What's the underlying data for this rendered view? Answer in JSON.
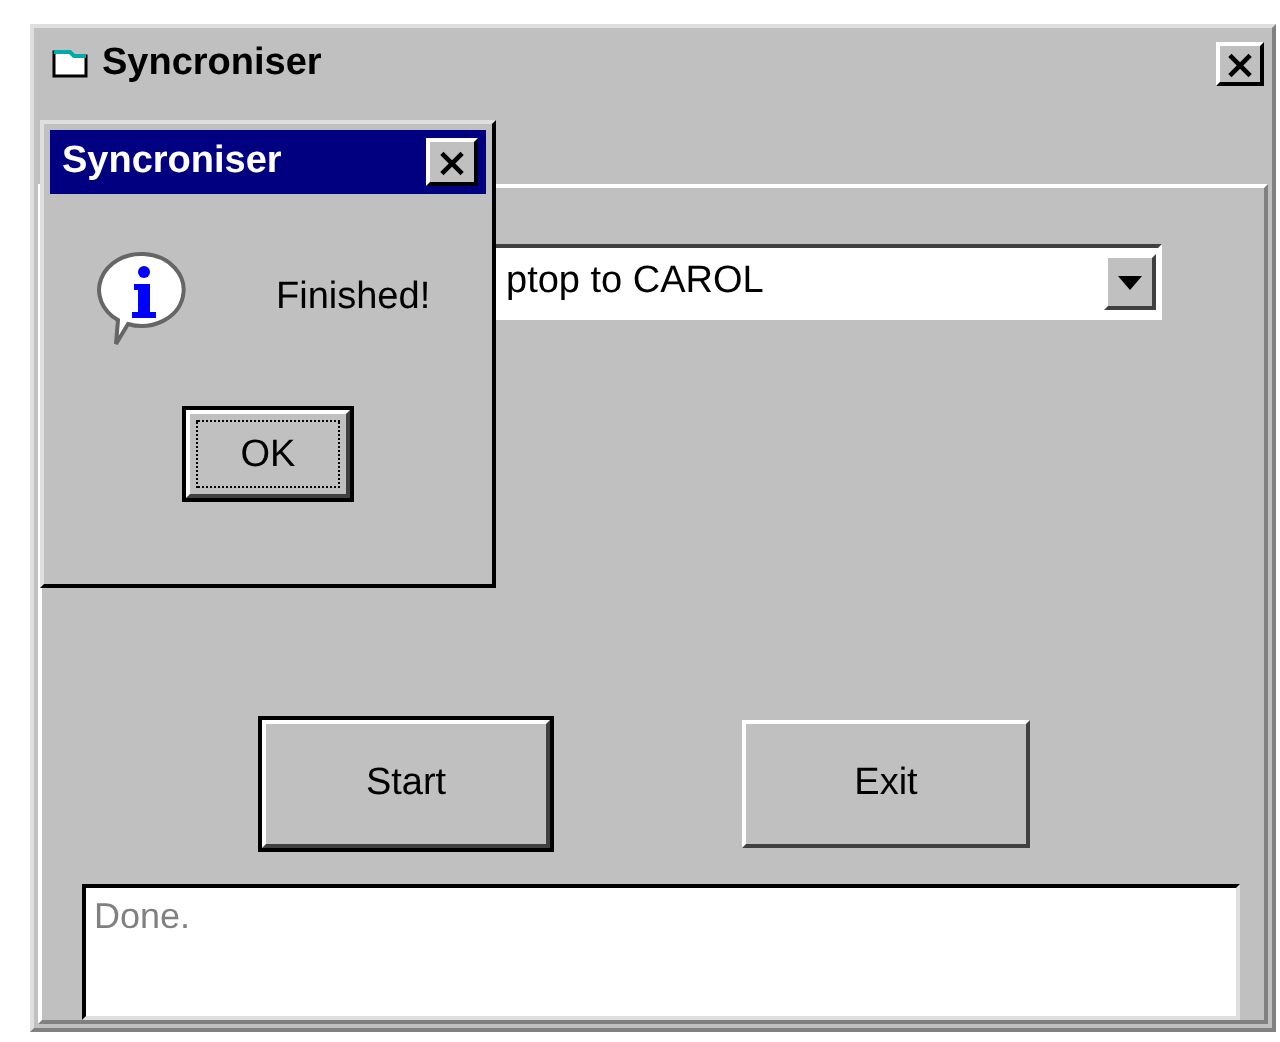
{
  "window": {
    "title": "Syncroniser",
    "close": "×"
  },
  "dropdown": {
    "value": "ptop to CAROL"
  },
  "buttons": [
    {
      "label": "Start",
      "default": true
    },
    {
      "label": "Exit",
      "default": false
    }
  ],
  "status": {
    "value": "Done."
  },
  "dialog": {
    "title": "Syncroniser",
    "close": "×",
    "message": "Finished!",
    "button": "OK"
  }
}
